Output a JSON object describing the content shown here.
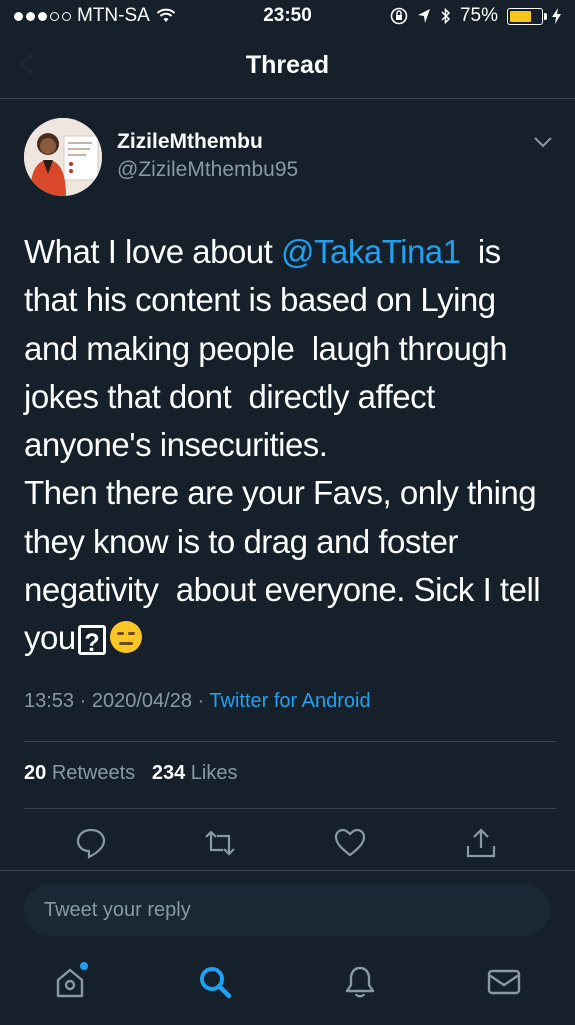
{
  "status_bar": {
    "carrier": "MTN-SA",
    "time": "23:50",
    "battery": "75%",
    "battery_level": 0.75,
    "accent": "#f5c518"
  },
  "nav": {
    "title": "Thread",
    "back_icon": "back-arrow-icon"
  },
  "tweet": {
    "author_name": "ZizileMthembu",
    "author_handle": "@ZizileMthembu95",
    "text_before_mention": "What I love about ",
    "mention": "@TakaTina1",
    "text_after_mention": "  is that his content is based on Lying and making people  laugh through jokes that dont  directly affect anyone's insecurities.\nThen there are your Favs, only thing they know is to drag and foster negativity  about everyone. Sick I tell you",
    "unknown_glyph": "?",
    "emoji_icon": "expressionless-face-icon",
    "time": "13:53",
    "date": "2020/04/28",
    "sep": "·",
    "source": "Twitter for Android"
  },
  "stats": {
    "retweets_count": "20",
    "retweets_label": "Retweets",
    "likes_count": "234",
    "likes_label": "Likes"
  },
  "actions": [
    "reply-icon",
    "retweet-icon",
    "like-icon",
    "share-icon"
  ],
  "reply_box": {
    "placeholder": "Tweet your reply"
  },
  "tabs": [
    "home-icon",
    "search-icon",
    "notifications-icon",
    "messages-icon"
  ],
  "colors": {
    "background": "#15202b",
    "accent": "#1da1f2",
    "secondary_text": "#8899a6",
    "divider": "#38444d"
  }
}
